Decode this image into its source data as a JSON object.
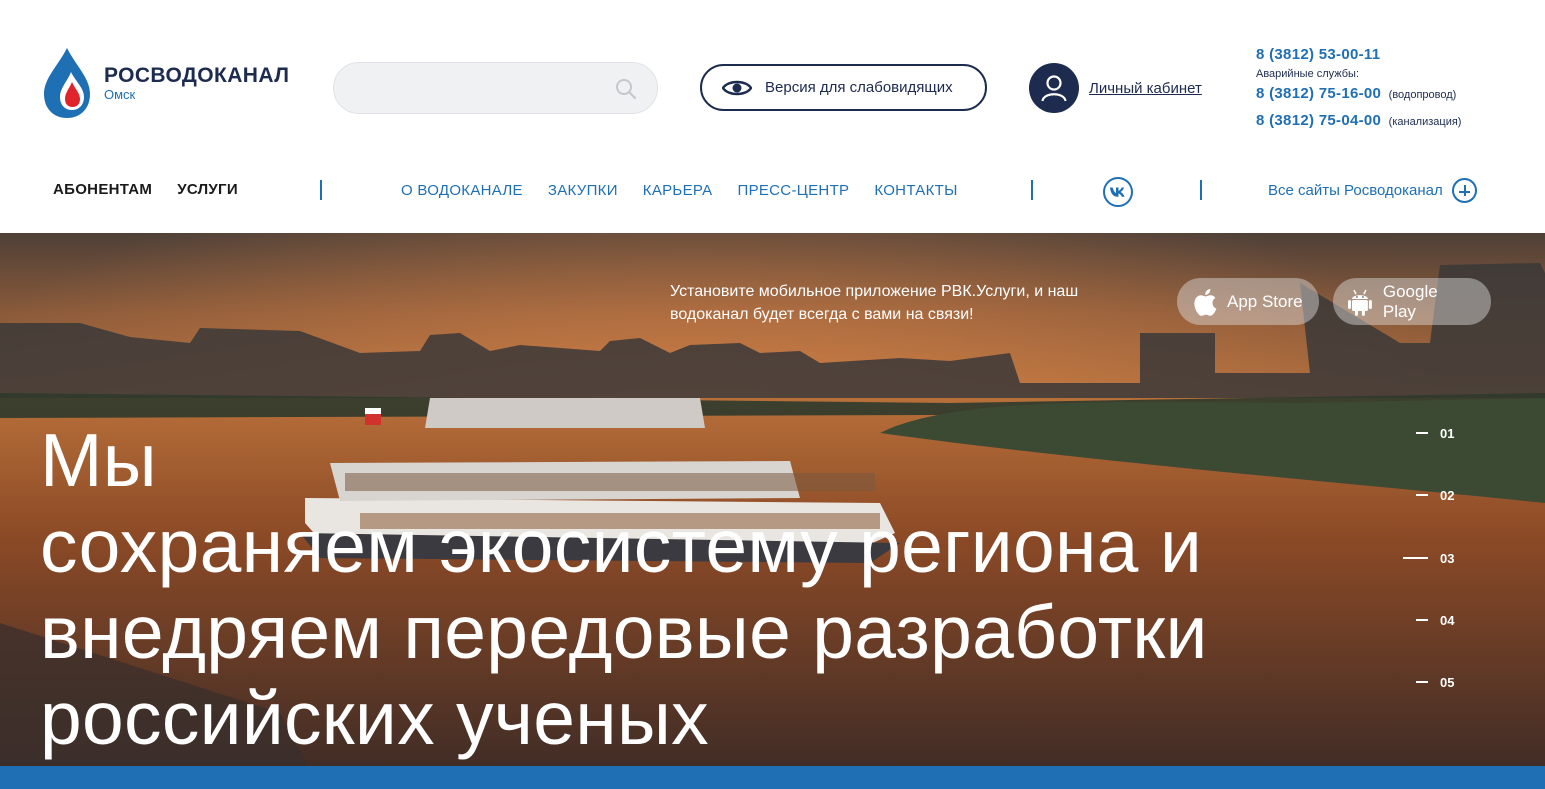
{
  "logo": {
    "name": "РОСВОДОКАНАЛ",
    "city": "Омск"
  },
  "search": {
    "placeholder": ""
  },
  "vision_button": {
    "label": "Версия для слабовидящих"
  },
  "cabinet": {
    "label": "Личный кабинет"
  },
  "phones": {
    "main": "8 (3812) 53-00-11",
    "emergency_label": "Аварийные службы:",
    "water": "8 (3812) 75-16-00",
    "water_note": "(водопровод)",
    "sewer": "8 (3812) 75-04-00",
    "sewer_note": "(канализация)"
  },
  "nav": {
    "primary": [
      "АБОНЕНТАМ",
      "УСЛУГИ"
    ],
    "secondary": [
      "О ВОДОКАНАЛЕ",
      "ЗАКУПКИ",
      "КАРЬЕРА",
      "ПРЕСС-ЦЕНТР",
      "КОНТАКТЫ"
    ],
    "social_icon": "vk-icon",
    "all_sites": "Все сайты Росводоканал"
  },
  "hero": {
    "promo_line1": "Установите мобильное приложение РВК.Услуги, и наш",
    "promo_line2": "водоканал будет всегда с вами на связи!",
    "app_store": "App Store",
    "google_play": "Google Play",
    "title_lines": [
      "Мы",
      "сохраняем экосистему региона и",
      "внедряем передовые разработки",
      "российских ученых"
    ],
    "slides": [
      "01",
      "02",
      "03",
      "04",
      "05"
    ],
    "active_slide": "03"
  },
  "colors": {
    "brand_dark": "#1d2b4f",
    "brand_blue": "#1f6fb5",
    "logo_red": "#e0242b"
  }
}
